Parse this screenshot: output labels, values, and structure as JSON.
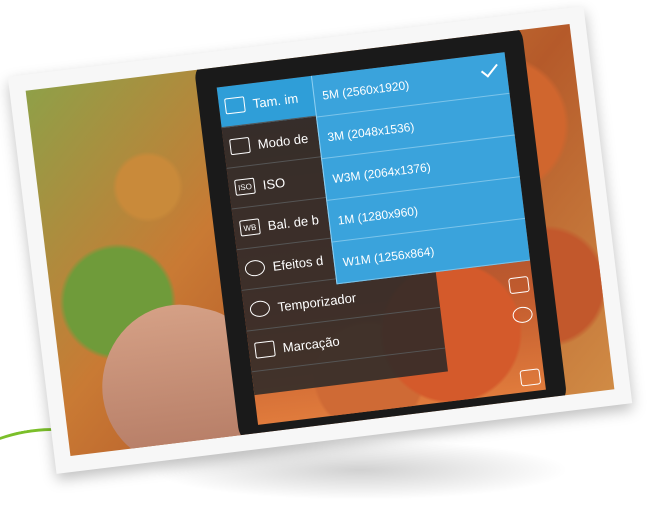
{
  "settings_menu": {
    "items": [
      {
        "icon": "image-size-icon",
        "label": "Tam. im"
      },
      {
        "icon": "scene-mode-icon",
        "label": "Modo de"
      },
      {
        "icon": "iso-icon",
        "icon_text": "ISO",
        "label": "ISO"
      },
      {
        "icon": "white-balance-icon",
        "icon_text": "WB",
        "label": "Bal. de b"
      },
      {
        "icon": "palette-icon",
        "label": "Efeitos d"
      },
      {
        "icon": "timer-icon",
        "label": "Temporizador"
      },
      {
        "icon": "watermark-icon",
        "label": "Marcação"
      }
    ]
  },
  "resolution_popup": {
    "options": [
      {
        "label": "5M (2560x1920)",
        "selected": true
      },
      {
        "label": "3M (2048x1536)",
        "selected": false
      },
      {
        "label": "W3M (2064x1376)",
        "selected": false
      },
      {
        "label": "1M (1280x960)",
        "selected": false
      },
      {
        "label": "W1M (1256x864)",
        "selected": false
      }
    ],
    "check_icon": "check-icon"
  },
  "colors": {
    "popup_blue": "#3aa3dc",
    "active_blue": "#2f9ed8",
    "accent_green": "#7bbf2a"
  }
}
